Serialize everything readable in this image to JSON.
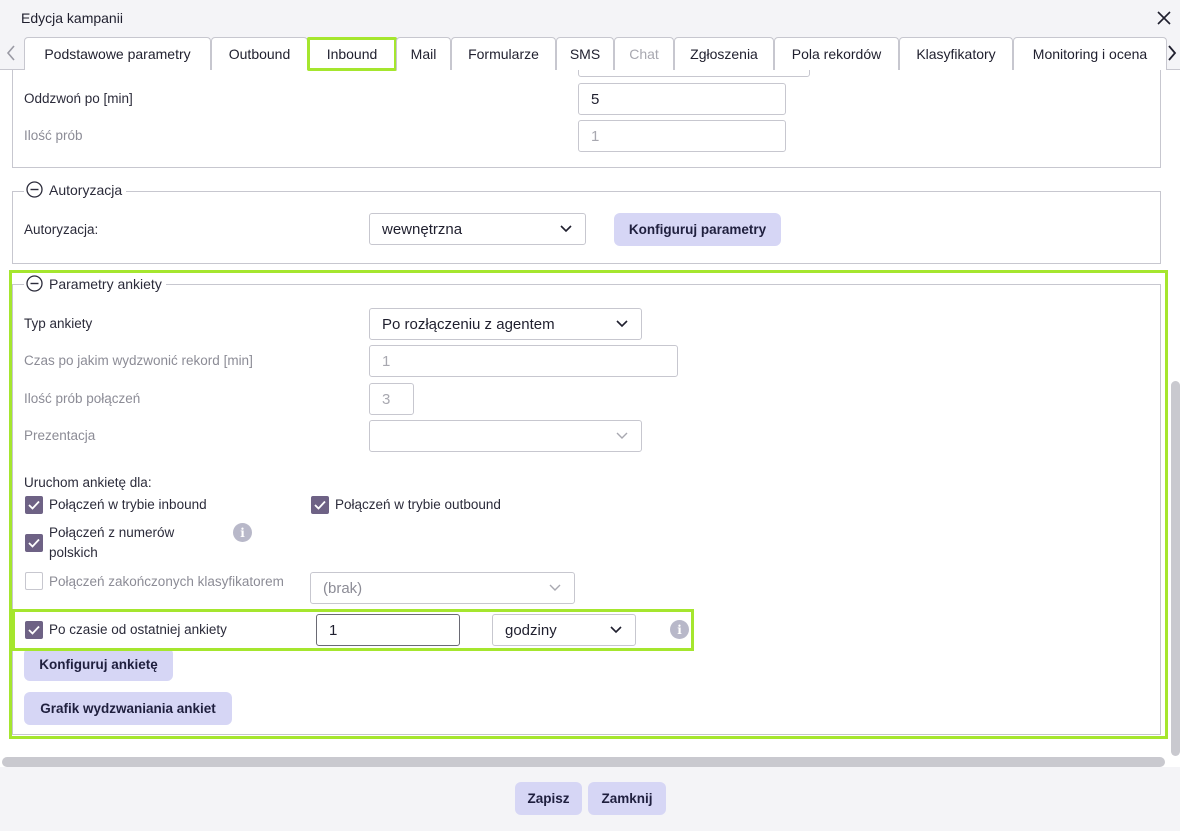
{
  "window": {
    "title": "Edycja kampanii"
  },
  "tabs": [
    {
      "label": "Podstawowe parametry"
    },
    {
      "label": "Outbound"
    },
    {
      "label": "Inbound"
    },
    {
      "label": "Mail"
    },
    {
      "label": "Formularze"
    },
    {
      "label": "SMS"
    },
    {
      "label": "Chat"
    },
    {
      "label": "Zgłoszenia"
    },
    {
      "label": "Pola rekordów"
    },
    {
      "label": "Klasyfikatory"
    },
    {
      "label": "Monitoring i ocena"
    }
  ],
  "callback": {
    "call_after_label": "Oddzwoń po [min]",
    "call_after_value": "5",
    "attempts_label": "Ilość prób",
    "attempts_value": "1"
  },
  "authorization": {
    "legend": "Autoryzacja",
    "label": "Autoryzacja:",
    "select_value": "wewnętrzna",
    "configure_button": "Konfiguruj parametry"
  },
  "survey": {
    "legend": "Parametry ankiety",
    "type_label": "Typ ankiety",
    "type_value": "Po rozłączeniu z agentem",
    "delay_label": "Czas po jakim wydzwonić rekord [min]",
    "delay_value": "1",
    "attempts_label": "Ilość prób połączeń",
    "attempts_value": "3",
    "presentation_label": "Prezentacja",
    "presentation_value": "",
    "run_for_label": "Uruchom ankietę dla:",
    "cb_inbound": "Połączeń w trybie inbound",
    "cb_outbound": "Połączeń w trybie outbound",
    "cb_polish_line1": "Połączeń z numerów",
    "cb_polish_line2": "polskich",
    "cb_classifier": "Połączeń zakończonych klasyfikatorem",
    "classifier_value": "(brak)",
    "cb_since_last": "Po czasie od ostatniej ankiety",
    "since_last_value": "1",
    "since_last_unit": "godziny",
    "configure_button": "Konfiguruj ankietę",
    "schedule_button": "Grafik wydzwaniania ankiet"
  },
  "footer": {
    "save": "Zapisz",
    "close": "Zamknij"
  },
  "colors": {
    "highlight": "#a5e62e",
    "button_bg": "#d6d6f5",
    "checkbox": "#6e6285"
  }
}
